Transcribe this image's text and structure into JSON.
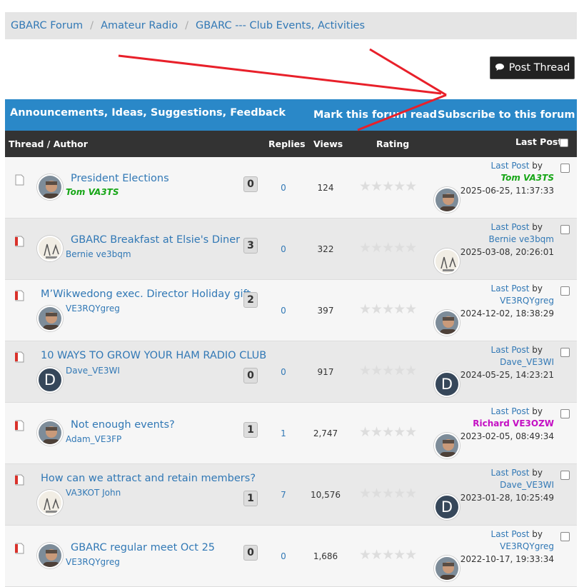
{
  "breadcrumb": [
    "GBARC Forum",
    "Amateur Radio",
    "GBARC --- Club Events, Activities"
  ],
  "post_thread": "Post Thread",
  "forum_header": {
    "title": "Announcements, Ideas, Suggestions, Feedback",
    "mark_read": "Mark this forum read",
    "subscribe": "Subscribe to this forum"
  },
  "columns": {
    "thread_author": "Thread / Author",
    "replies": "Replies",
    "views": "Views",
    "rating": "Rating",
    "last_post": "Last Post"
  },
  "threads": [
    {
      "title": "President Elections",
      "author": "Tom VA3TS",
      "author_style": "green",
      "badge": "0",
      "replies": "0",
      "views": "124",
      "lp_label": "Last Post",
      "lp_by": "by",
      "lp_user": "Tom VA3TS",
      "lp_user_style": "green",
      "lp_date": "2025-06-25, 11:37:33",
      "icon": "plain",
      "avatar": "photo"
    },
    {
      "title": "GBARC Breakfast at Elsie's Diner",
      "author": "Bernie ve3bqm",
      "author_style": "",
      "badge": "3",
      "replies": "0",
      "views": "322",
      "lp_label": "Last Post",
      "lp_by": "by",
      "lp_user": "Bernie ve3bqm",
      "lp_user_style": "",
      "lp_date": "2025-03-08, 20:26:01",
      "icon": "hot",
      "avatar": "sketch"
    },
    {
      "title": "M’Wikwedong exec. Director Holiday gift",
      "author": "VE3RQYgreg",
      "author_style": "",
      "badge": "2",
      "replies": "0",
      "views": "397",
      "lp_label": "Last Post",
      "lp_by": "by",
      "lp_user": "VE3RQYgreg",
      "lp_user_style": "",
      "lp_date": "2024-12-02, 18:38:29",
      "icon": "hot",
      "avatar": "photo"
    },
    {
      "title": "10 WAYS TO GROW YOUR HAM RADIO CLUB",
      "author": "Dave_VE3WI",
      "author_style": "",
      "badge": "0",
      "replies": "0",
      "views": "917",
      "lp_label": "Last Post",
      "lp_by": "by",
      "lp_user": "Dave_VE3WI",
      "lp_user_style": "",
      "lp_date": "2024-05-25, 14:23:21",
      "icon": "hot",
      "avatar": "D"
    },
    {
      "title": "Not enough events?",
      "author": "Adam_VE3FP",
      "author_style": "",
      "badge": "1",
      "replies": "1",
      "views": "2,747",
      "lp_label": "Last Post",
      "lp_by": "by",
      "lp_user": "Richard VE3OZW",
      "lp_user_style": "purple",
      "lp_date": "2023-02-05, 08:49:34",
      "icon": "hot",
      "avatar": "photo"
    },
    {
      "title": "How can we attract and retain members?",
      "author": "VA3KOT John",
      "author_style": "",
      "badge": "1",
      "replies": "7",
      "views": "10,576",
      "lp_label": "Last Post",
      "lp_by": "by",
      "lp_user": "Dave_VE3WI",
      "lp_user_style": "",
      "lp_date": "2023-01-28, 10:25:49",
      "icon": "hot",
      "avatar": "sketch"
    },
    {
      "title": "GBARC regular meet Oct 25",
      "author": "VE3RQYgreg",
      "author_style": "",
      "badge": "0",
      "replies": "0",
      "views": "1,686",
      "lp_label": "Last Post",
      "lp_by": "by",
      "lp_user": "VE3RQYgreg",
      "lp_user_style": "",
      "lp_date": "2022-10-17, 19:33:34",
      "icon": "hot",
      "avatar": "photo"
    }
  ],
  "colors": {
    "header_blue": "#2a88c8",
    "dark": "#333333",
    "link": "#3178b5",
    "arrow": "#e8202a"
  }
}
